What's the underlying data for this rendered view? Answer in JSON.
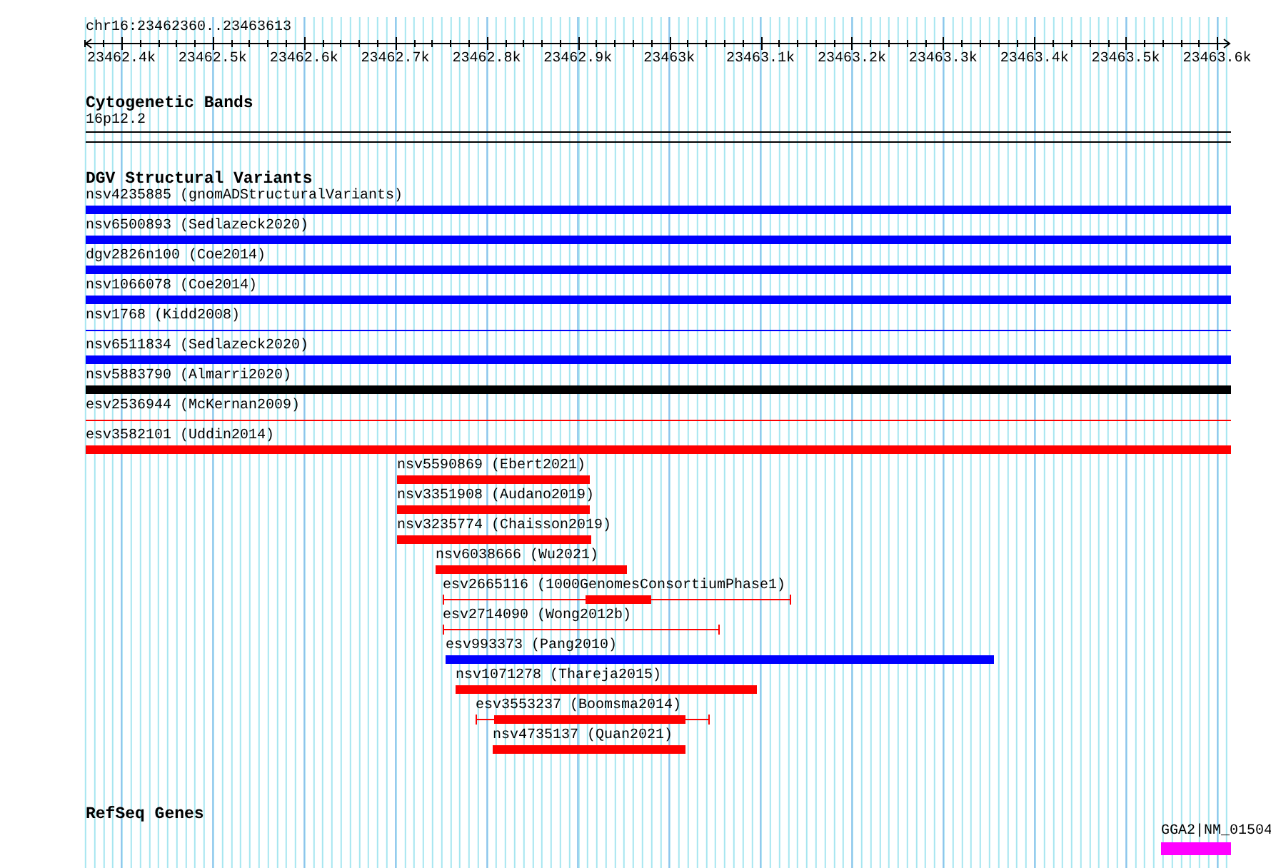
{
  "location": "chr16:23462360..23463613",
  "ruler": {
    "ticks": [
      "23462.4k",
      "23462.5k",
      "23462.6k",
      "23462.7k",
      "23462.8k",
      "23462.9k",
      "23463k",
      "23463.1k",
      "23463.2k",
      "23463.3k",
      "23463.4k",
      "23463.5k",
      "23463.6k"
    ]
  },
  "tracks": [
    {
      "title": "Cytogenetic Bands",
      "kind": "bands",
      "features": [
        {
          "label": "16p12.2"
        }
      ]
    },
    {
      "title": "DGV Structural Variants",
      "kind": "variants",
      "features": [
        {
          "label": "nsv4235885 (gnomADStructuralVariants)",
          "kind": "bar",
          "color": "#0000ff"
        },
        {
          "label": "nsv6500893 (Sedlazeck2020)",
          "kind": "bar",
          "color": "#0000ff"
        },
        {
          "label": "dgv2826n100 (Coe2014)",
          "kind": "bar",
          "color": "#0000ff"
        },
        {
          "label": "nsv1066078 (Coe2014)",
          "kind": "bar",
          "color": "#0000ff"
        },
        {
          "label": "nsv1768 (Kidd2008)",
          "kind": "line",
          "color": "#0000ff"
        },
        {
          "label": "nsv6511834 (Sedlazeck2020)",
          "kind": "bar",
          "color": "#0000ff"
        },
        {
          "label": "nsv5883790 (Almarri2020)",
          "kind": "bar",
          "color": "#000000"
        },
        {
          "label": "esv2536944 (McKernan2009)",
          "kind": "line",
          "color": "#ff0000"
        },
        {
          "label": "esv3582101 (Uddin2014)",
          "kind": "bar",
          "color": "#ff0000"
        },
        {
          "label": "nsv5590869 (Ebert2021)",
          "kind": "bar",
          "color": "#ff0000"
        },
        {
          "label": "nsv3351908 (Audano2019)",
          "kind": "bar",
          "color": "#ff0000"
        },
        {
          "label": "nsv3235774 (Chaisson2019)",
          "kind": "bar",
          "color": "#ff0000"
        },
        {
          "label": "nsv6038666 (Wu2021)",
          "kind": "bar",
          "color": "#ff0000"
        },
        {
          "label": "esv2665116 (1000GenomesConsortiumPhase1)",
          "kind": "capped",
          "color": "#ff0000"
        },
        {
          "label": "esv2714090 (Wong2012b)",
          "kind": "capped",
          "color": "#ff0000"
        },
        {
          "label": "esv993373 (Pang2010)",
          "kind": "bar",
          "color": "#0000ff"
        },
        {
          "label": "nsv1071278 (Thareja2015)",
          "kind": "bar",
          "color": "#ff0000"
        },
        {
          "label": "esv3553237 (Boomsma2014)",
          "kind": "capped",
          "color": "#ff0000"
        },
        {
          "label": "nsv4735137 (Quan2021)",
          "kind": "bar",
          "color": "#ff0000"
        }
      ]
    },
    {
      "title": "RefSeq Genes",
      "kind": "genes",
      "features": [
        {
          "label": "GGA2|NM_01504",
          "color": "#ff00ff"
        }
      ]
    }
  ]
}
